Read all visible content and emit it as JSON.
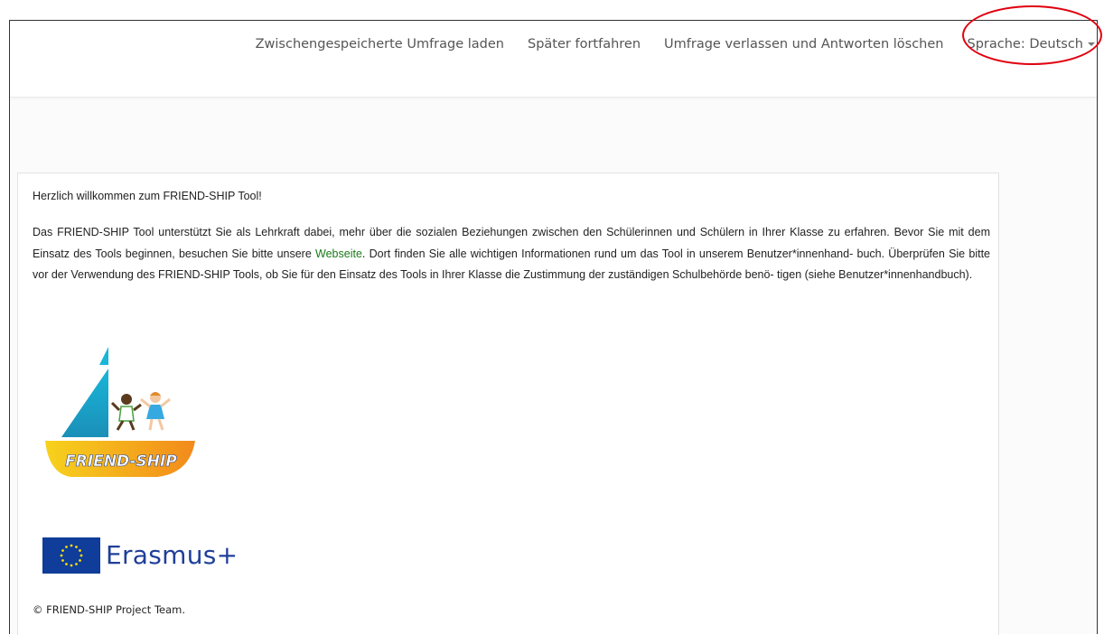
{
  "nav": {
    "load_saved": "Zwischengespeicherte Umfrage laden",
    "continue_later": "Später fortfahren",
    "exit_delete": "Umfrage verlassen und Antworten löschen",
    "language": "Sprache: Deutsch"
  },
  "content": {
    "welcome": "Herzlich willkommen zum FRIEND-SHIP Tool!",
    "intro_before_link": "Das FRIEND-SHIP Tool unterstützt Sie als Lehrkraft dabei, mehr über die sozialen Beziehungen zwischen den Schülerinnen und Schülern in Ihrer Klasse zu erfahren. Bevor Sie mit dem Einsatz des Tools beginnen, besuchen Sie bitte unsere ",
    "intro_link": "Webseite",
    "intro_after_link": ". Dort finden Sie alle wichtigen Informationen rund um das Tool in unserem Benutzer*innenhand- buch. Überprüfen Sie bitte vor der Verwendung des FRIEND-SHIP Tools, ob Sie für den Einsatz des Tools in Ihrer Klasse die Zustimmung der zuständigen Schulbehörde benö- tigen (siehe Benutzer*innenhandbuch)."
  },
  "logos": {
    "friendship": "FRIEND-SHIP",
    "erasmus": "Erasmus+"
  },
  "footer": "© FRIEND-SHIP Project Team.",
  "colors": {
    "highlight": "#e0000f",
    "link": "#1a7a1a",
    "eu_blue": "#0f3d99",
    "eu_star": "#ffdd00"
  }
}
